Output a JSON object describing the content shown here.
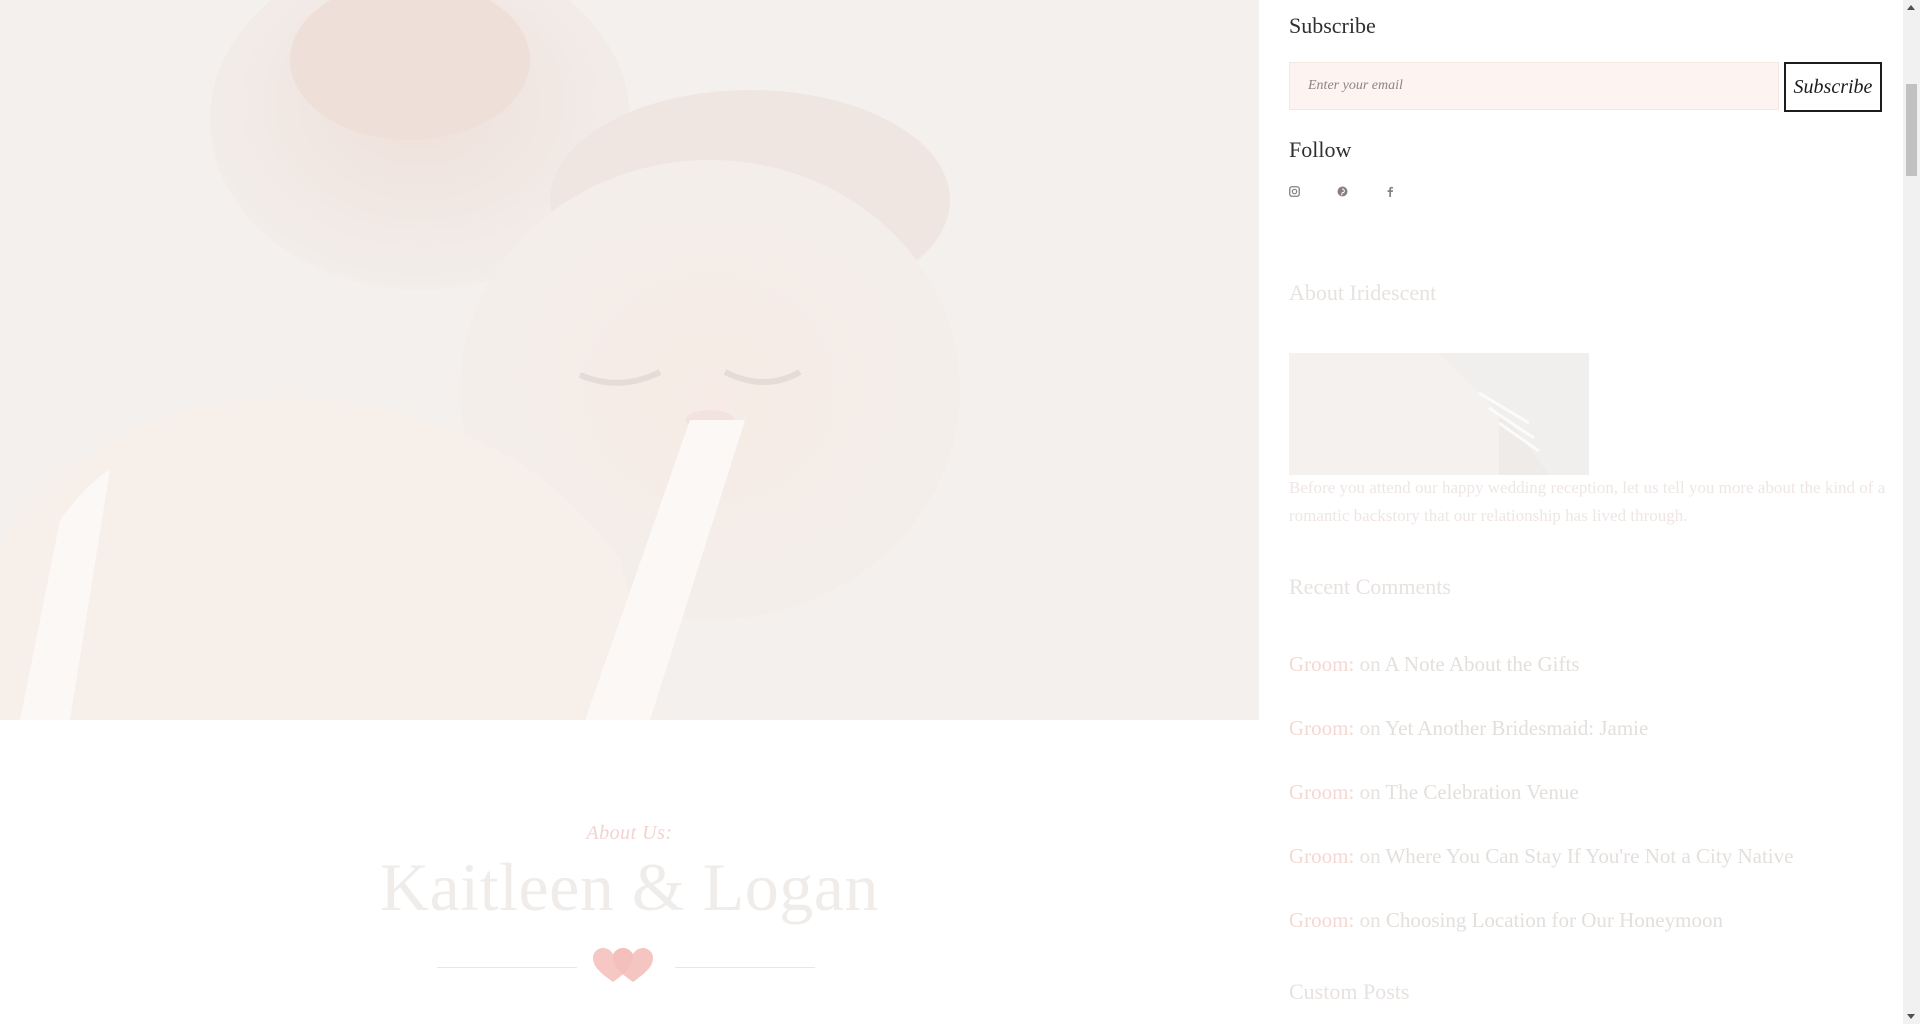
{
  "about_section": {
    "kicker": "About Us:",
    "title": "Kaitleen & Logan"
  },
  "sidebar": {
    "subscribe": {
      "title": "Subscribe",
      "email_placeholder": "Enter your email",
      "button_label": "Subscribe"
    },
    "follow": {
      "title": "Follow",
      "icons": [
        "instagram-icon",
        "pinterest-icon",
        "facebook-icon"
      ]
    },
    "about": {
      "title": "About Iridescent",
      "text": "Before you attend our happy wedding reception, let us tell you more about the kind of a romantic backstory that our relationship has lived through."
    },
    "recent_comments": {
      "title": "Recent Comments",
      "items": [
        {
          "author": "Groom:",
          "joiner": "on",
          "post": "A Note About the Gifts"
        },
        {
          "author": "Groom:",
          "joiner": "on",
          "post": "Yet Another Bridesmaid: Jamie"
        },
        {
          "author": "Groom:",
          "joiner": "on",
          "post": "The Celebration Venue"
        },
        {
          "author": "Groom:",
          "joiner": "on",
          "post": "Where You Can Stay If You're Not a City Native"
        },
        {
          "author": "Groom:",
          "joiner": "on",
          "post": "Choosing Location for Our Honeymoon"
        }
      ]
    },
    "custom_posts": {
      "title": "Custom Posts"
    }
  },
  "colors": {
    "accent_pink": "#f4d8d3",
    "heart_pink": "#f6c7c3",
    "input_bg": "#fdf3f1",
    "text_dark": "#2f2f2f"
  }
}
